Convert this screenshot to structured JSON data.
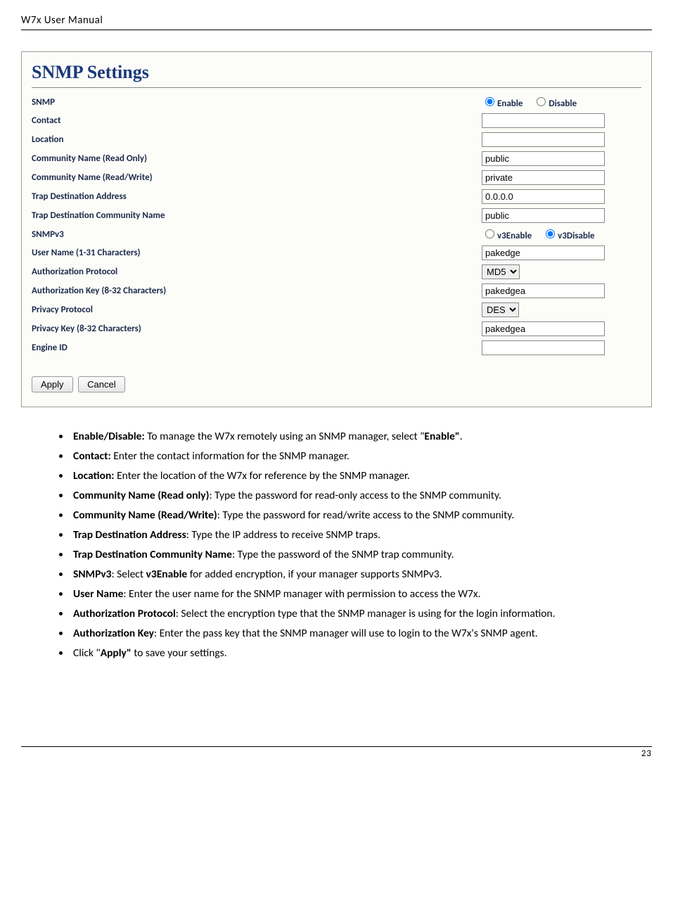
{
  "header": {
    "title": "W7x  User Manual"
  },
  "panel": {
    "title": "SNMP Settings",
    "rows": {
      "snmp_label": "SNMP",
      "snmp_enable": "Enable",
      "snmp_disable": "Disable",
      "contact_label": "Contact",
      "contact_value": "",
      "location_label": "Location",
      "location_value": "",
      "cro_label": "Community Name (Read Only)",
      "cro_value": "public",
      "crw_label": "Community Name (Read/Write)",
      "crw_value": "private",
      "tda_label": "Trap Destination Address",
      "tda_value": "0.0.0.0",
      "tdcn_label": "Trap Destination Community Name",
      "tdcn_value": "public",
      "snmpv3_label": "SNMPv3",
      "v3enable": "v3Enable",
      "v3disable": "v3Disable",
      "user_label": "User Name (1-31 Characters)",
      "user_value": "pakedge",
      "authp_label": "Authorization Protocol",
      "authp_value": "MD5",
      "authk_label": "Authorization Key (8-32 Characters)",
      "authk_value": "pakedgea",
      "privp_label": "Privacy Protocol",
      "privp_value": "DES",
      "privk_label": "Privacy Key (8-32 Characters)",
      "privk_value": "pakedgea",
      "engine_label": "Engine ID",
      "engine_value": ""
    },
    "buttons": {
      "apply": "Apply",
      "cancel": "Cancel"
    }
  },
  "bullets": [
    {
      "b": "Enable/Disable:",
      "t": " To manage the W7x remotely using an SNMP manager, select \"",
      "b2": "Enable\"",
      "t2": "."
    },
    {
      "b": "Contact:",
      "t": " Enter the contact information for the SNMP manager."
    },
    {
      "b": "Location:",
      "t": " Enter the location of the W7x for reference by the SNMP manager."
    },
    {
      "b": "Community Name (Read only)",
      "t": ": Type the password for read-only access to the SNMP community."
    },
    {
      "b": "Community Name (Read/Write)",
      "t": ": Type the password for read/write access to the SNMP community."
    },
    {
      "b": "Trap Destination Address",
      "t": ": Type the IP address to receive SNMP traps."
    },
    {
      "b": "Trap Destination Community Name",
      "t": ": Type the password of the SNMP trap community."
    },
    {
      "b": "SNMPv3",
      "t": ": Select ",
      "b2": "v3Enable",
      "t2": " for added encryption, if your manager supports SNMPv3."
    },
    {
      "b": "User Name",
      "t": ": Enter the user name for the SNMP manager with permission to access the W7x."
    },
    {
      "b": "Authorization Protocol",
      "t": ": Select the encryption type that the SNMP manager is using for the login information."
    },
    {
      "b": "Authorization Key",
      "t": ": Enter the pass key that the SNMP manager will use to login to the W7x's SNMP agent."
    },
    {
      "b": "",
      "t": "Click \"",
      "b2": "Apply\"",
      "t2": " to save your settings."
    }
  ],
  "footer": {
    "page": "23"
  }
}
